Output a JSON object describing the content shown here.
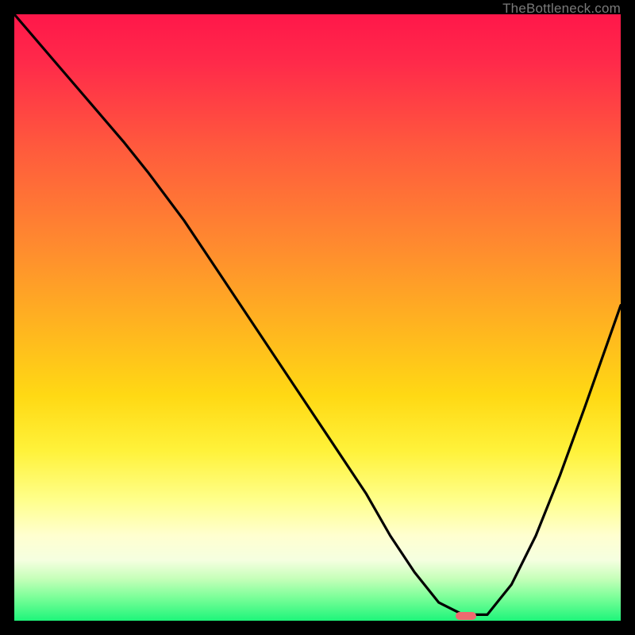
{
  "watermark": "TheBottleneck.com",
  "colors": {
    "frame_bg": "#000000",
    "curve": "#000000",
    "marker": "#ef6a6f",
    "gradient_top": "#ff174a",
    "gradient_bottom": "#1ef57a"
  },
  "chart_data": {
    "type": "line",
    "title": "",
    "xlabel": "",
    "ylabel": "",
    "x_range_pct": [
      0,
      100
    ],
    "y_range_pct": [
      0,
      100
    ],
    "series": [
      {
        "name": "bottleneck-curve",
        "x_pct": [
          0,
          6,
          12,
          18,
          22,
          28,
          34,
          40,
          46,
          52,
          58,
          62,
          66,
          70,
          74,
          78,
          82,
          86,
          90,
          94,
          100
        ],
        "y_pct": [
          100,
          93,
          86,
          79,
          74,
          66,
          57,
          48,
          39,
          30,
          21,
          14,
          8,
          3,
          1,
          1,
          6,
          14,
          24,
          35,
          52
        ]
      }
    ],
    "ylim": [
      0,
      100
    ],
    "marker": {
      "x_pct": 74.5,
      "y_pct": 0.8
    },
    "note": "x and y are percentages of the plot area; y=0 is the bottom (green), y=100 is the top (red)."
  }
}
